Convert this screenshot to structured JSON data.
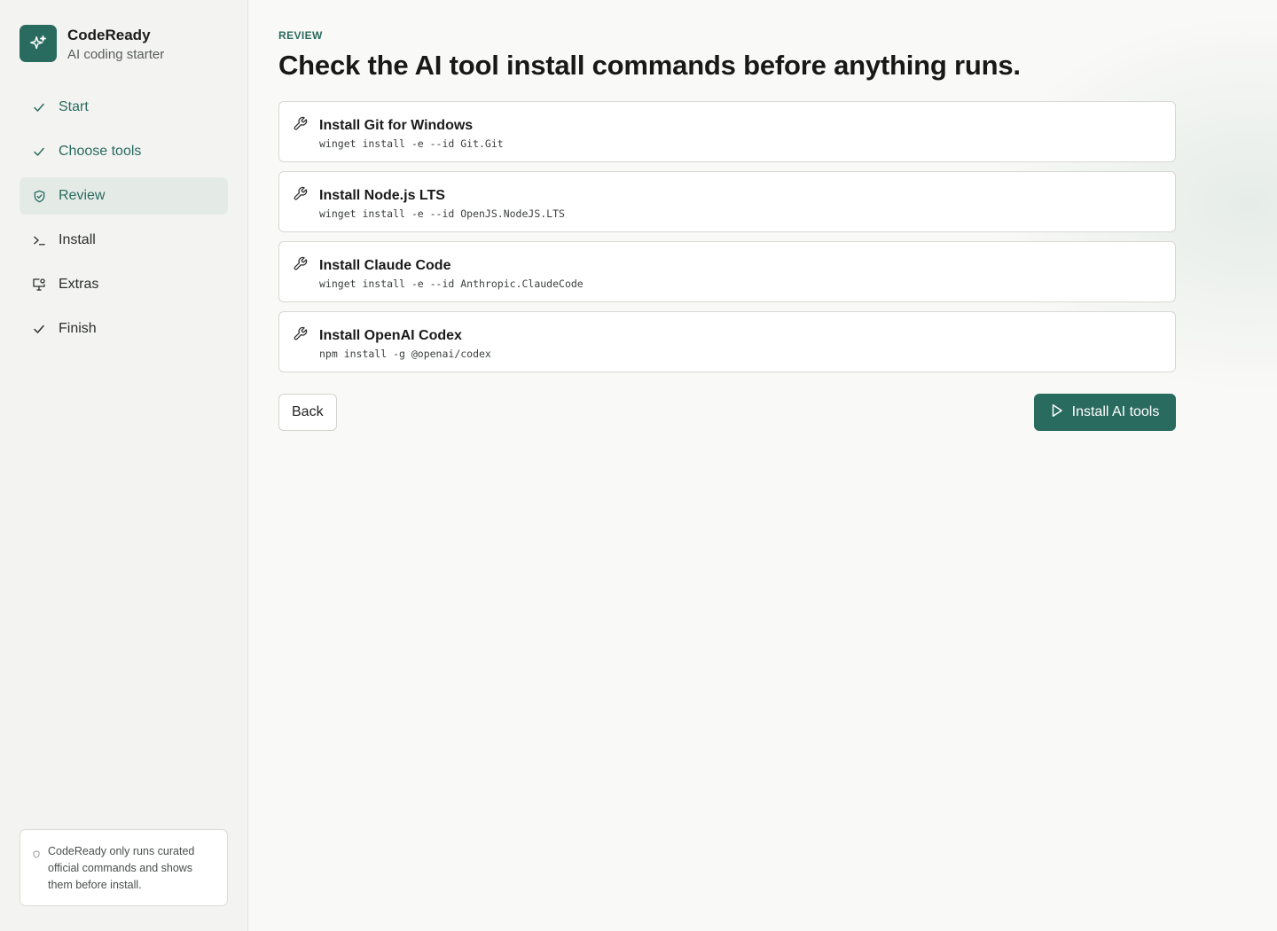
{
  "brand": {
    "name": "CodeReady",
    "subtitle": "AI coding starter",
    "logo_icon": "sparkles-icon",
    "accent_color": "#2a6b5f"
  },
  "nav": {
    "items": [
      {
        "label": "Start",
        "icon": "check-icon",
        "state": "done"
      },
      {
        "label": "Choose tools",
        "icon": "check-icon",
        "state": "done"
      },
      {
        "label": "Review",
        "icon": "shield-check-icon",
        "state": "active"
      },
      {
        "label": "Install",
        "icon": "terminal-icon",
        "state": "pending"
      },
      {
        "label": "Extras",
        "icon": "monitor-settings-icon",
        "state": "pending"
      },
      {
        "label": "Finish",
        "icon": "check-icon",
        "state": "pending"
      }
    ]
  },
  "note": {
    "text": "CodeReady only runs curated official commands and shows them before install.",
    "icon": "shield-icon"
  },
  "main": {
    "eyebrow": "Review",
    "title": "Check the AI tool install commands before anything runs."
  },
  "commands": [
    {
      "title": "Install Git for Windows",
      "code": "winget install -e --id Git.Git",
      "icon": "wrench-icon"
    },
    {
      "title": "Install Node.js LTS",
      "code": "winget install -e --id OpenJS.NodeJS.LTS",
      "icon": "wrench-icon"
    },
    {
      "title": "Install Claude Code",
      "code": "winget install -e --id Anthropic.ClaudeCode",
      "icon": "wrench-icon"
    },
    {
      "title": "Install OpenAI Codex",
      "code": "npm install -g @openai/codex",
      "icon": "wrench-icon"
    }
  ],
  "actions": {
    "back_label": "Back",
    "primary_label": "Install AI tools",
    "primary_icon": "play-icon"
  }
}
